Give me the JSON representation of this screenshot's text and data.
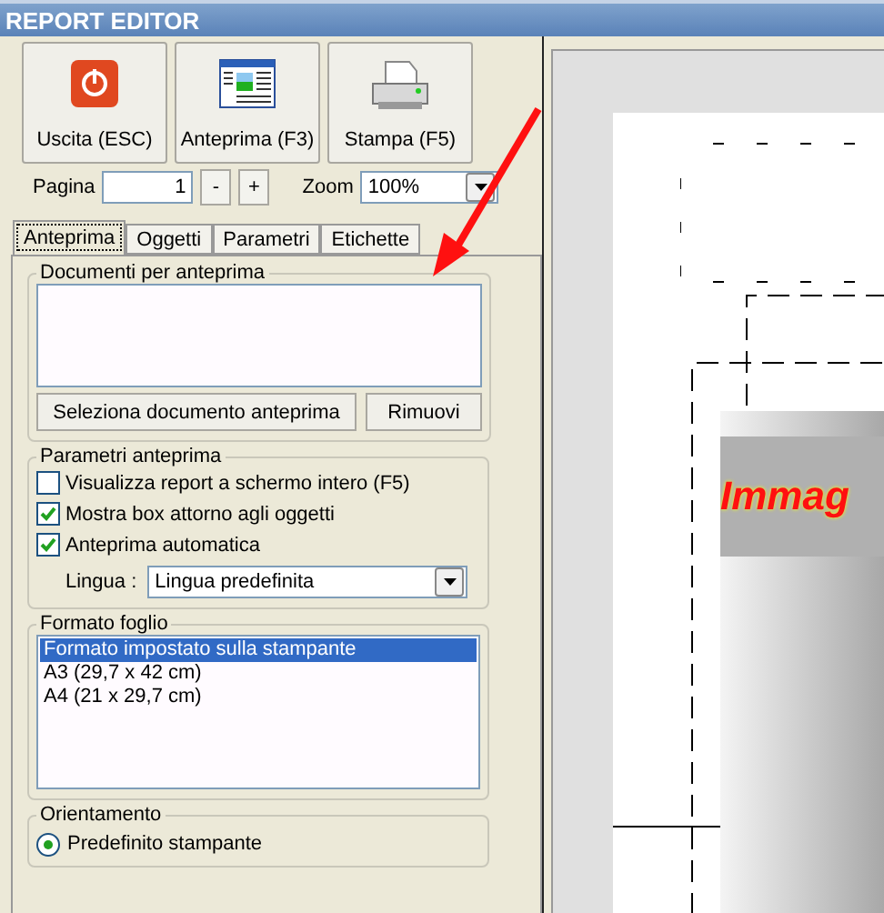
{
  "window": {
    "title": "REPORT EDITOR"
  },
  "toolbar": [
    {
      "kind": "exit",
      "label": "Uscita (ESC)"
    },
    {
      "kind": "preview",
      "label": "Anteprima (F3)"
    },
    {
      "kind": "print",
      "label": "Stampa (F5)"
    }
  ],
  "pager": {
    "label": "Pagina",
    "value": "1",
    "minus": "-",
    "plus": "+",
    "zoom_label": "Zoom",
    "zoom_value": "100%"
  },
  "tabs": [
    {
      "label": "Anteprima",
      "selected": true
    },
    {
      "label": "Oggetti",
      "selected": false
    },
    {
      "label": "Parametri",
      "selected": false
    },
    {
      "label": "Etichette",
      "selected": false
    }
  ],
  "documents": {
    "title": "Documenti per anteprima",
    "select_button": "Seleziona documento anteprima",
    "remove_button": "Rimuovi"
  },
  "preview_params": {
    "title": "Parametri anteprima",
    "options": [
      {
        "label": "Visualizza report a schermo intero (F5)",
        "checked": false
      },
      {
        "label": "Mostra box attorno agli oggetti",
        "checked": true
      },
      {
        "label": "Anteprima automatica",
        "checked": true
      }
    ],
    "language_label": "Lingua :",
    "language_value": "Lingua predefinita"
  },
  "sheet_format": {
    "title": "Formato foglio",
    "items": [
      {
        "label": "Formato impostato sulla stampante",
        "selected": true
      },
      {
        "label": "A3 (29,7 x 42 cm)",
        "selected": false
      },
      {
        "label": "A4 (21 x 29,7 cm)",
        "selected": false
      }
    ]
  },
  "orientation": {
    "title": "Orientamento",
    "options": [
      {
        "label": "Predefinito stampante",
        "selected": true
      }
    ]
  },
  "canvas": {
    "image_text": "Immag"
  }
}
